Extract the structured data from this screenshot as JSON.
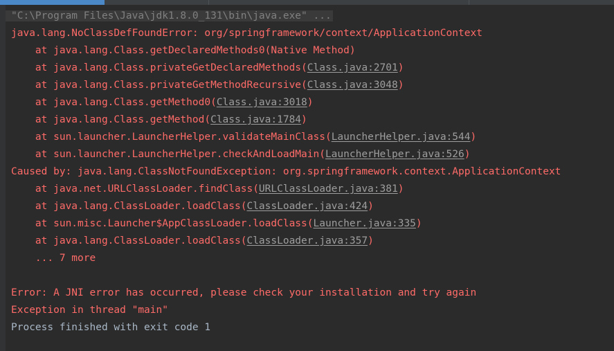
{
  "window": {
    "background_color": "#2b2b2b",
    "gutter_color": "#313335",
    "accent_color": "#4a88c7",
    "error_color": "#ff6b68",
    "text_color": "#a9b7c6",
    "link_color": "#9e9e9e"
  },
  "toolbar": {
    "progress_label": "",
    "progress_percent": 17
  },
  "console": {
    "lines": [
      {
        "id": "command-line",
        "highlight": true,
        "segments": [
          {
            "role": "dim",
            "text": "\"C:\\Program Files\\Java\\jdk1.8.0_131\\bin\\java.exe\" ..."
          }
        ]
      },
      {
        "id": "exception-header",
        "highlight": false,
        "segments": [
          {
            "role": "red",
            "text": "java.lang.NoClassDefFoundError: org/springframework/context/ApplicationContext"
          }
        ]
      },
      {
        "id": "frame-1",
        "highlight": false,
        "segments": [
          {
            "role": "red",
            "text": "\tat java.lang.Class.getDeclaredMethods0(Native Method)"
          }
        ]
      },
      {
        "id": "frame-2",
        "highlight": false,
        "segments": [
          {
            "role": "red",
            "text": "\tat java.lang.Class.privateGetDeclaredMethods("
          },
          {
            "role": "link",
            "text": "Class.java:2701"
          },
          {
            "role": "red",
            "text": ")"
          }
        ]
      },
      {
        "id": "frame-3",
        "highlight": false,
        "segments": [
          {
            "role": "red",
            "text": "\tat java.lang.Class.privateGetMethodRecursive("
          },
          {
            "role": "link",
            "text": "Class.java:3048"
          },
          {
            "role": "red",
            "text": ")"
          }
        ]
      },
      {
        "id": "frame-4",
        "highlight": false,
        "segments": [
          {
            "role": "red",
            "text": "\tat java.lang.Class.getMethod0("
          },
          {
            "role": "link",
            "text": "Class.java:3018"
          },
          {
            "role": "red",
            "text": ")"
          }
        ]
      },
      {
        "id": "frame-5",
        "highlight": false,
        "segments": [
          {
            "role": "red",
            "text": "\tat java.lang.Class.getMethod("
          },
          {
            "role": "link",
            "text": "Class.java:1784"
          },
          {
            "role": "red",
            "text": ")"
          }
        ]
      },
      {
        "id": "frame-6",
        "highlight": false,
        "segments": [
          {
            "role": "red",
            "text": "\tat sun.launcher.LauncherHelper.validateMainClass("
          },
          {
            "role": "link",
            "text": "LauncherHelper.java:544"
          },
          {
            "role": "red",
            "text": ")"
          }
        ]
      },
      {
        "id": "frame-7",
        "highlight": false,
        "segments": [
          {
            "role": "red",
            "text": "\tat sun.launcher.LauncherHelper.checkAndLoadMain("
          },
          {
            "role": "link",
            "text": "LauncherHelper.java:526"
          },
          {
            "role": "red",
            "text": ")"
          }
        ]
      },
      {
        "id": "caused-by",
        "highlight": false,
        "segments": [
          {
            "role": "red",
            "text": "Caused by: java.lang.ClassNotFoundException: org.springframework.context.ApplicationContext"
          }
        ]
      },
      {
        "id": "frame-8",
        "highlight": false,
        "segments": [
          {
            "role": "red",
            "text": "\tat java.net.URLClassLoader.findClass("
          },
          {
            "role": "link",
            "text": "URLClassLoader.java:381"
          },
          {
            "role": "red",
            "text": ")"
          }
        ]
      },
      {
        "id": "frame-9",
        "highlight": false,
        "segments": [
          {
            "role": "red",
            "text": "\tat java.lang.ClassLoader.loadClass("
          },
          {
            "role": "link",
            "text": "ClassLoader.java:424"
          },
          {
            "role": "red",
            "text": ")"
          }
        ]
      },
      {
        "id": "frame-10",
        "highlight": false,
        "segments": [
          {
            "role": "red",
            "text": "\tat sun.misc.Launcher$AppClassLoader.loadClass("
          },
          {
            "role": "link",
            "text": "Launcher.java:335"
          },
          {
            "role": "red",
            "text": ")"
          }
        ]
      },
      {
        "id": "frame-11",
        "highlight": false,
        "segments": [
          {
            "role": "red",
            "text": "\tat java.lang.ClassLoader.loadClass("
          },
          {
            "role": "link",
            "text": "ClassLoader.java:357"
          },
          {
            "role": "red",
            "text": ")"
          }
        ]
      },
      {
        "id": "frame-more",
        "highlight": false,
        "segments": [
          {
            "role": "red",
            "text": "\t... 7 more"
          }
        ]
      },
      {
        "id": "blank-1",
        "highlight": false,
        "segments": [
          {
            "role": "red",
            "text": ""
          }
        ]
      },
      {
        "id": "jni-error",
        "highlight": false,
        "segments": [
          {
            "role": "red",
            "text": "Error: A JNI error has occurred, please check your installation and try again"
          }
        ]
      },
      {
        "id": "exception-main",
        "highlight": false,
        "segments": [
          {
            "role": "red",
            "text": "Exception in thread \"main\""
          }
        ]
      },
      {
        "id": "process-finished",
        "highlight": false,
        "segments": [
          {
            "role": "gray",
            "text": "Process finished with exit code 1"
          }
        ]
      }
    ]
  }
}
